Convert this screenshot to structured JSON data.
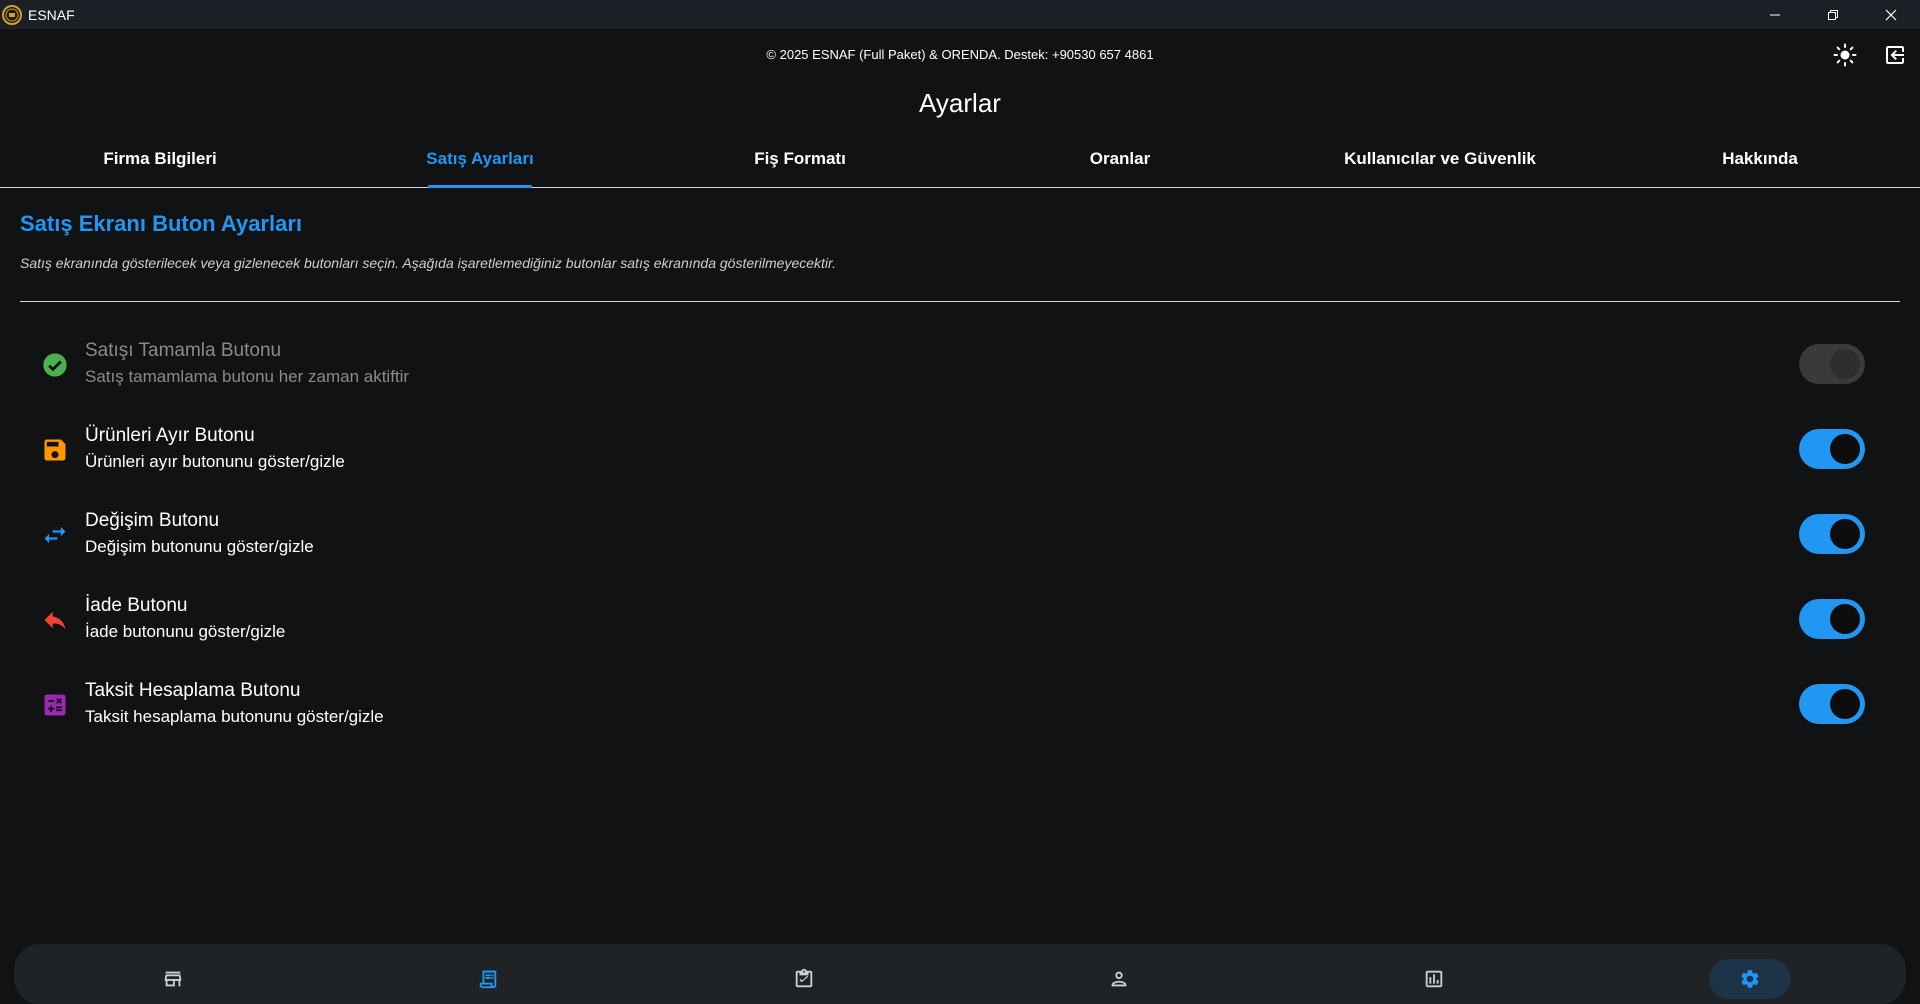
{
  "window": {
    "app_title": "ESNAF",
    "logo_text": "ESNAF",
    "icons": {
      "minimize": "minimize-icon",
      "maximize": "restore-icon",
      "close": "close-icon"
    }
  },
  "header": {
    "copyright": "© 2025 ESNAF (Full Paket) & ORENDA. Destek: +90530 657 4861",
    "theme_icon": "sun-icon",
    "logout_icon": "logout-icon"
  },
  "page": {
    "title": "Ayarlar"
  },
  "tabs": [
    {
      "label": "Firma Bilgileri",
      "active": false
    },
    {
      "label": "Satış Ayarları",
      "active": true
    },
    {
      "label": "Fiş Formatı",
      "active": false
    },
    {
      "label": "Oranlar",
      "active": false
    },
    {
      "label": "Kullanıcılar ve Güvenlik",
      "active": false
    },
    {
      "label": "Hakkında",
      "active": false
    }
  ],
  "section": {
    "title": "Satış Ekranı Buton Ayarları",
    "description": "Satış ekranında gösterilecek veya gizlenecek butonları seçin. Aşağıda işaretlemediğiniz butonlar satış ekranında gösterilmeyecektir."
  },
  "settings": [
    {
      "title": "Satışı Tamamla Butonu",
      "subtitle": "Satış tamamlama butonu her zaman aktiftir",
      "icon": "check-circle-icon",
      "icon_color": "#4caf50",
      "enabled": true,
      "disabled": true
    },
    {
      "title": "Ürünleri Ayır Butonu",
      "subtitle": "Ürünleri ayır butonunu göster/gizle",
      "icon": "save-icon",
      "icon_color": "#ff9800",
      "enabled": true,
      "disabled": false
    },
    {
      "title": "Değişim Butonu",
      "subtitle": "Değişim butonunu göster/gizle",
      "icon": "swap-icon",
      "icon_color": "#2196f3",
      "enabled": true,
      "disabled": false
    },
    {
      "title": "İade Butonu",
      "subtitle": "İade butonunu göster/gizle",
      "icon": "undo-icon",
      "icon_color": "#f44336",
      "enabled": true,
      "disabled": false
    },
    {
      "title": "Taksit Hesaplama Butonu",
      "subtitle": "Taksit hesaplama butonunu göster/gizle",
      "icon": "calculator-icon",
      "icon_color": "#9c27b0",
      "enabled": true,
      "disabled": false
    }
  ],
  "bottom_nav": [
    {
      "icon": "store-icon",
      "active": false
    },
    {
      "icon": "receipt-icon",
      "active": false
    },
    {
      "icon": "clipboard-check-icon",
      "active": false
    },
    {
      "icon": "person-icon",
      "active": false
    },
    {
      "icon": "bar-chart-icon",
      "active": false
    },
    {
      "icon": "gear-icon",
      "active": true
    }
  ],
  "colors": {
    "accent": "#2196f3",
    "background": "#111213",
    "titlebar": "#1b2026"
  }
}
